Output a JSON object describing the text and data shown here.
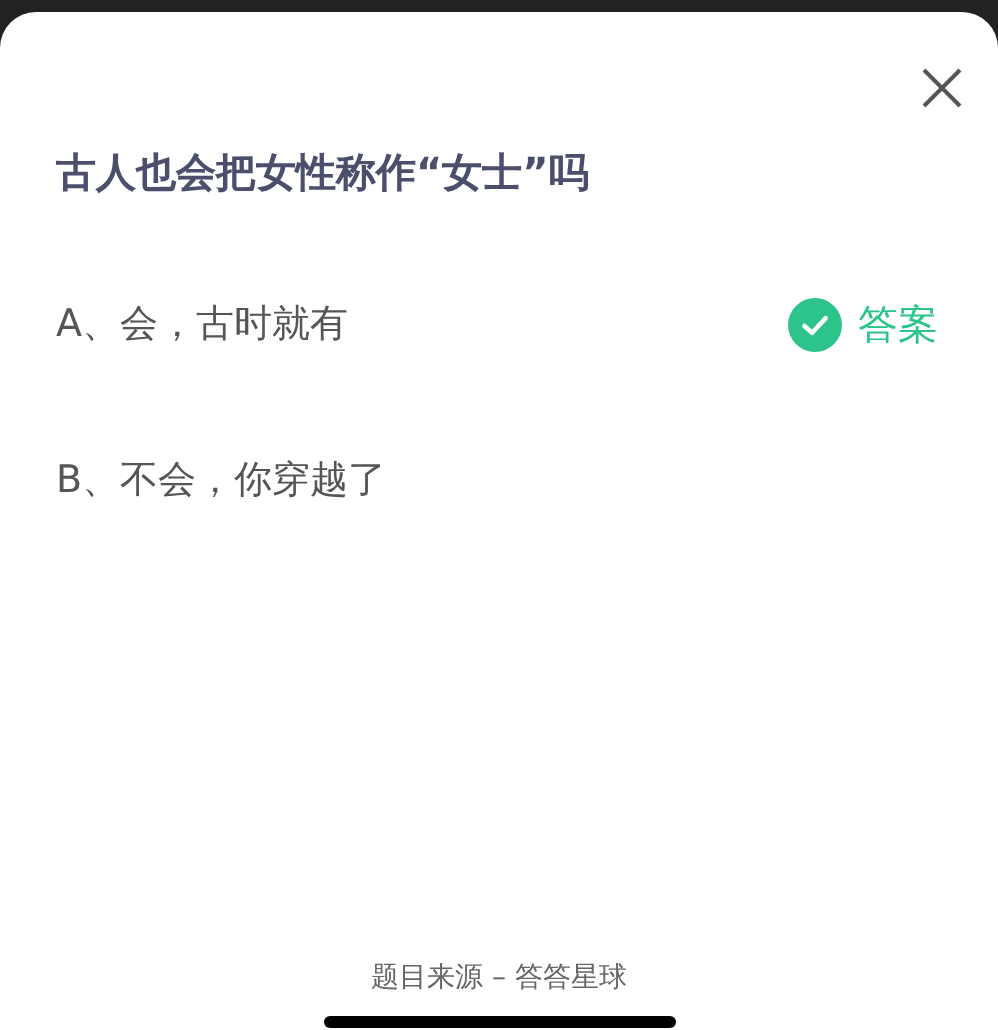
{
  "question": "古人也会把女性称作“女士”吗",
  "answer_badge": "答案",
  "options": [
    {
      "label": "A、会，古时就有",
      "correct": true
    },
    {
      "label": "B、不会，你穿越了",
      "correct": false
    }
  ],
  "footer": "题目来源 – 答答星球"
}
